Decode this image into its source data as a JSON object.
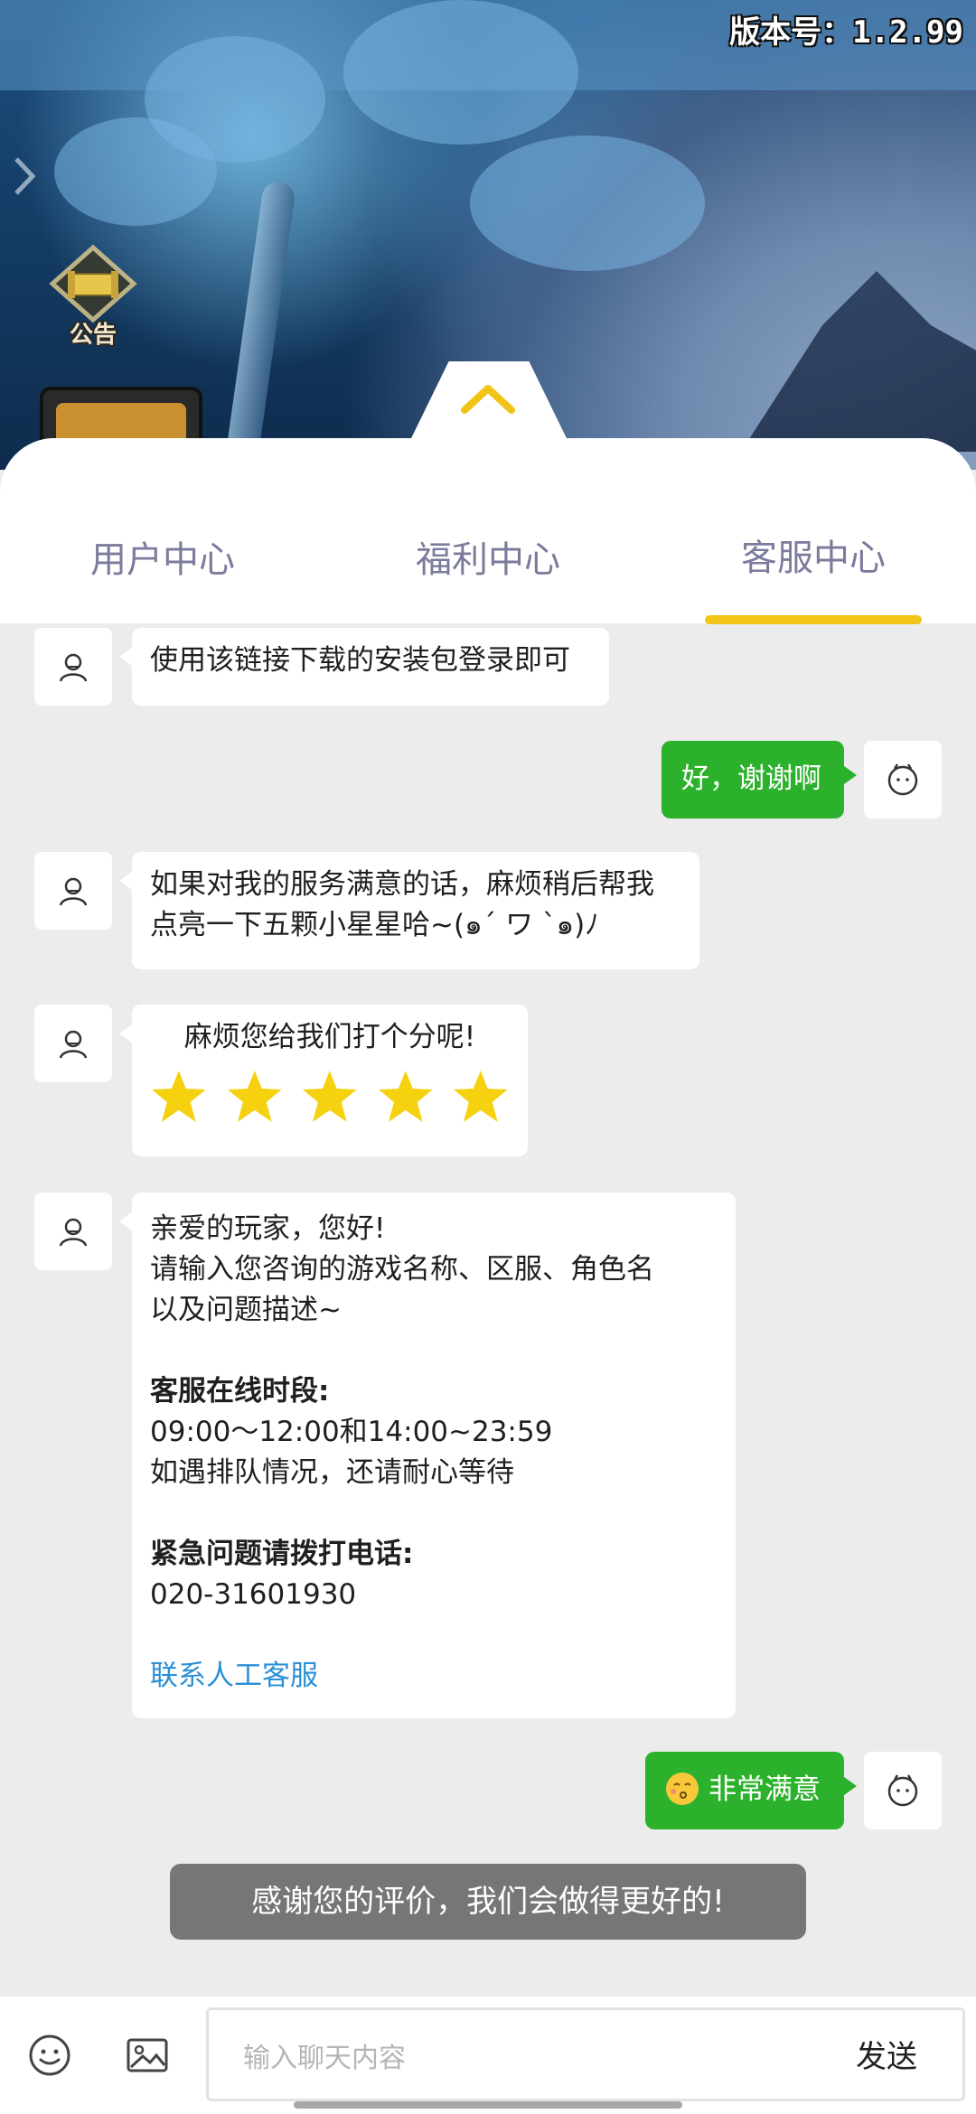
{
  "game": {
    "version": "版本号：1.2.99",
    "notice_label": "公告"
  },
  "tabs": [
    {
      "label": "用户中心",
      "active": false
    },
    {
      "label": "福利中心",
      "active": false
    },
    {
      "label": "客服中心",
      "active": true
    }
  ],
  "messages": {
    "m1": "使用该链接下载的安装包登录即可",
    "m2": "好，谢谢啊",
    "m3_line1": "如果对我的服务满意的话，麻烦稍后帮我",
    "m3_line2": "点亮一下五颗小星星哈~(๑ˊ ワ ˋ๑)ﾉ",
    "m4_title": "麻烦您给我们打个分呢!",
    "m4_rating": 5,
    "m5": {
      "greeting": "亲爱的玩家，您好!",
      "ask_line1": "请输入您咨询的游戏名称、区服、角色名",
      "ask_line2": "以及问题描述~",
      "hours_title": "客服在线时段:",
      "hours": "09:00～12:00和14:00~23:59",
      "queue": "如遇排队情况，还请耐心等待",
      "urgent_title": "紧急问题请拨打电话:",
      "phone": "020-31601930",
      "link": "联系人工客服"
    },
    "m6": "非常满意"
  },
  "toast": "感谢您的评价，我们会做得更好的!",
  "input": {
    "placeholder": "输入聊天内容",
    "send": "发送"
  },
  "colors": {
    "accent": "#f2c417",
    "bubble_green": "#2bb12b",
    "link": "#2a8fd6",
    "tab_text": "#7b7b9c"
  }
}
